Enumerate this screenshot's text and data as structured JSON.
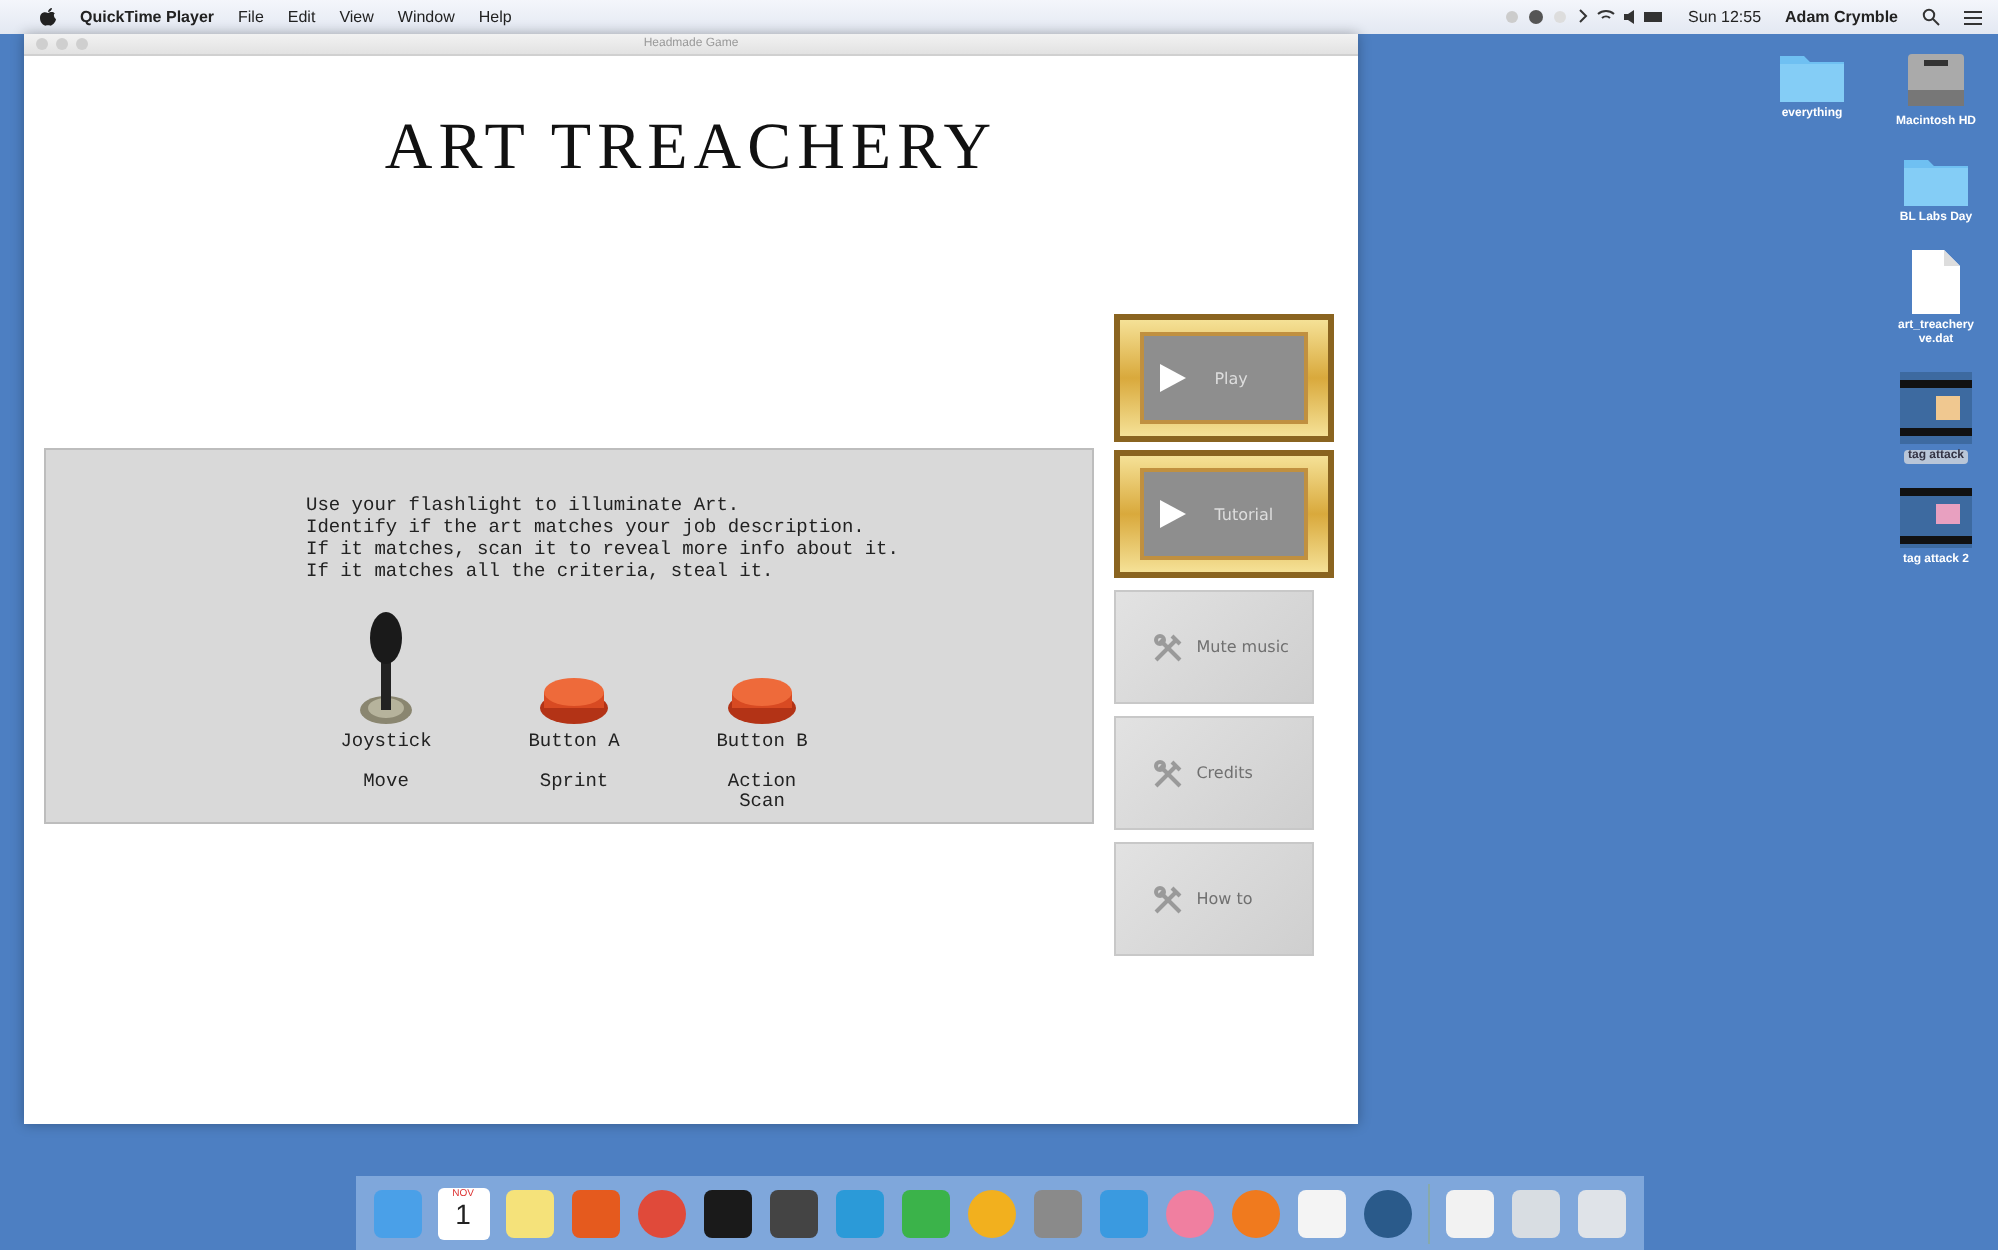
{
  "menu_bar": {
    "app_name": "QuickTime Player",
    "menus": [
      "File",
      "Edit",
      "View",
      "Window",
      "Help"
    ],
    "clock": "Sun 12:55",
    "user": "Adam Crymble"
  },
  "window": {
    "title": "Headmade Game",
    "heading": "ART TREACHERY",
    "instructions": [
      "Use your flashlight to illuminate Art.",
      "Identify if the art matches your job description.",
      "If it matches, scan it to reveal more info about it.",
      "If it matches all the criteria, steal it."
    ],
    "controls": [
      {
        "kind": "joystick",
        "name": "Joystick",
        "action": "Move"
      },
      {
        "kind": "button",
        "name": "Button A",
        "action": "Sprint"
      },
      {
        "kind": "button",
        "name": "Button B",
        "action": "Action Scan"
      }
    ],
    "menu_buttons": [
      {
        "kind": "framed",
        "label": "Play"
      },
      {
        "kind": "framed",
        "label": "Tutorial"
      },
      {
        "kind": "paper",
        "label": "Mute music"
      },
      {
        "kind": "paper",
        "label": "Credits"
      },
      {
        "kind": "paper",
        "label": "How to"
      }
    ]
  },
  "desktop": {
    "columns": [
      [
        {
          "kind": "folder",
          "label": "everything",
          "selected": false
        }
      ],
      [
        {
          "kind": "disk",
          "label": "Macintosh HD",
          "selected": false
        },
        {
          "kind": "folder",
          "label": "BL Labs Day",
          "selected": false
        },
        {
          "kind": "file",
          "label": "art_treachery ve.dat",
          "selected": false
        },
        {
          "kind": "movie",
          "label": "tag attack",
          "selected": true
        },
        {
          "kind": "movie2",
          "label": "tag attack 2",
          "selected": false
        }
      ]
    ]
  },
  "dock": {
    "calendar_month": "NOV",
    "calendar_day": "1",
    "apps": [
      {
        "kind": "finder"
      },
      {
        "kind": "calendar"
      },
      {
        "kind": "notes"
      },
      {
        "kind": "powerpoint"
      },
      {
        "kind": "chrome"
      },
      {
        "kind": "terminal"
      },
      {
        "kind": "digitalcolor"
      },
      {
        "kind": "word"
      },
      {
        "kind": "excel"
      },
      {
        "kind": "outlook"
      },
      {
        "kind": "preferences"
      },
      {
        "kind": "twitter"
      },
      {
        "kind": "photos"
      },
      {
        "kind": "firefox"
      },
      {
        "kind": "java"
      },
      {
        "kind": "quicktime"
      },
      {
        "kind": "separator"
      },
      {
        "kind": "document"
      },
      {
        "kind": "screens"
      },
      {
        "kind": "trash"
      }
    ]
  }
}
